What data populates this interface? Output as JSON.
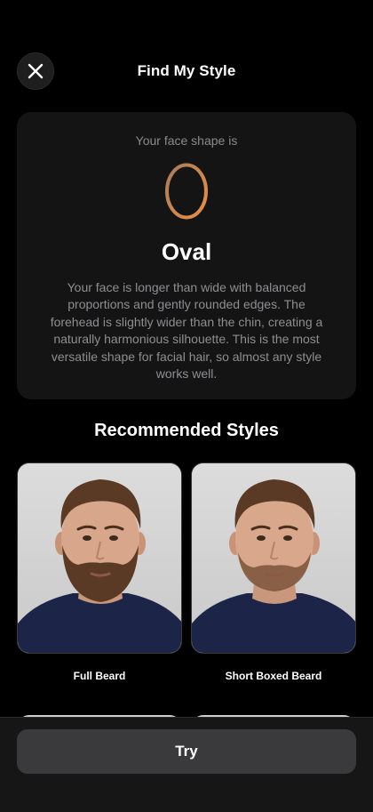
{
  "header": {
    "title": "Find My Style",
    "close_icon": "close-icon"
  },
  "face_shape": {
    "subtitle": "Your face shape is",
    "icon": "oval-shape-icon",
    "name": "Oval",
    "description": "Your face is longer than wide with balanced proportions and gently rounded edges. The forehead is slightly wider than the chin, creating a naturally harmonious silhouette. This is the most versatile shape for facial hair, so almost any style works well.",
    "gradient": [
      "#b07a52",
      "#e3904a"
    ]
  },
  "recommended": {
    "title": "Recommended Styles",
    "styles": [
      {
        "label": "Full Beard",
        "image": "man-with-full-beard-photo"
      },
      {
        "label": "Short Boxed Beard",
        "image": "man-with-short-boxed-beard-photo"
      }
    ]
  },
  "actions": {
    "try_label": "Try"
  },
  "colors": {
    "background": "#000000",
    "card": "#141414",
    "button": "#3a3a3c"
  }
}
